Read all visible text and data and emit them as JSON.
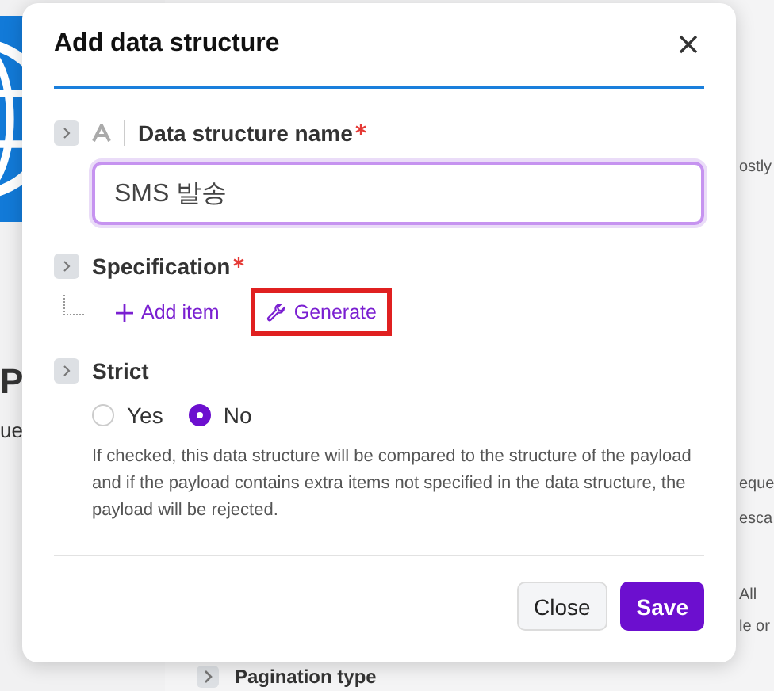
{
  "background": {
    "left_texts": [
      "P",
      "ue"
    ],
    "right_texts": [
      "ostly",
      "eque",
      "esca",
      "All",
      "le or"
    ],
    "bottom_section": {
      "label": "Pagination type"
    }
  },
  "dialog": {
    "title": "Add data structure",
    "fields": [
      {
        "kind": "text",
        "label": "Data structure name",
        "required": true,
        "value": "SMS 발송"
      },
      {
        "kind": "actions",
        "label": "Specification",
        "required": true,
        "actions": [
          {
            "kind": "add",
            "label": "Add item",
            "highlighted": false
          },
          {
            "kind": "generate",
            "label": "Generate",
            "highlighted": true
          }
        ]
      },
      {
        "kind": "radio",
        "label": "Strict",
        "required": false,
        "options": [
          {
            "label": "Yes",
            "selected": false
          },
          {
            "label": "No",
            "selected": true
          }
        ],
        "help": "If checked, this data structure will be compared to the structure of the payload and if the payload contains extra items not specified in the data structure, the payload will be rejected."
      }
    ],
    "buttons": [
      {
        "label": "Close",
        "kind": "secondary"
      },
      {
        "label": "Save",
        "kind": "primary"
      }
    ]
  }
}
